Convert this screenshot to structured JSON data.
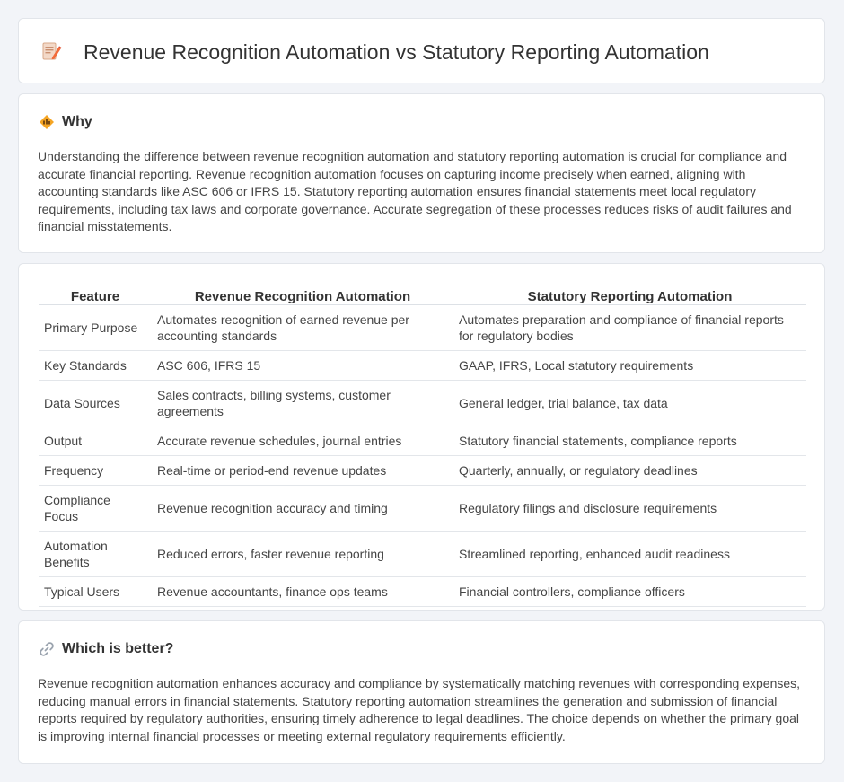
{
  "header": {
    "title": "Revenue Recognition Automation vs Statutory Reporting Automation",
    "icon": "document-pencil-icon"
  },
  "why": {
    "heading": "Why",
    "icon": "diamond-sign-icon",
    "text": "Understanding the difference between revenue recognition automation and statutory reporting automation is crucial for compliance and accurate financial reporting. Revenue recognition automation focuses on capturing income precisely when earned, aligning with accounting standards like ASC 606 or IFRS 15. Statutory reporting automation ensures financial statements meet local regulatory requirements, including tax laws and corporate governance. Accurate segregation of these processes reduces risks of audit failures and financial misstatements."
  },
  "table": {
    "headers": [
      "Feature",
      "Revenue Recognition Automation",
      "Statutory Reporting Automation"
    ],
    "rows": [
      [
        "Primary Purpose",
        "Automates recognition of earned revenue per accounting standards",
        "Automates preparation and compliance of financial reports for regulatory bodies"
      ],
      [
        "Key Standards",
        "ASC 606, IFRS 15",
        "GAAP, IFRS, Local statutory requirements"
      ],
      [
        "Data Sources",
        "Sales contracts, billing systems, customer agreements",
        "General ledger, trial balance, tax data"
      ],
      [
        "Output",
        "Accurate revenue schedules, journal entries",
        "Statutory financial statements, compliance reports"
      ],
      [
        "Frequency",
        "Real-time or period-end revenue updates",
        "Quarterly, annually, or regulatory deadlines"
      ],
      [
        "Compliance Focus",
        "Revenue recognition accuracy and timing",
        "Regulatory filings and disclosure requirements"
      ],
      [
        "Automation Benefits",
        "Reduced errors, faster revenue reporting",
        "Streamlined reporting, enhanced audit readiness"
      ],
      [
        "Typical Users",
        "Revenue accountants, finance ops teams",
        "Financial controllers, compliance officers"
      ]
    ]
  },
  "better": {
    "heading": "Which is better?",
    "icon": "link-icon",
    "text": "Revenue recognition automation enhances accuracy and compliance by systematically matching revenues with corresponding expenses, reducing manual errors in financial statements. Statutory reporting automation streamlines the generation and submission of financial reports required by regulatory authorities, ensuring timely adherence to legal deadlines. The choice depends on whether the primary goal is improving internal financial processes or meeting external regulatory requirements efficiently."
  },
  "colors": {
    "background": "#f2f4f8",
    "card": "#ffffff",
    "accent_orange": "#f0a030"
  }
}
